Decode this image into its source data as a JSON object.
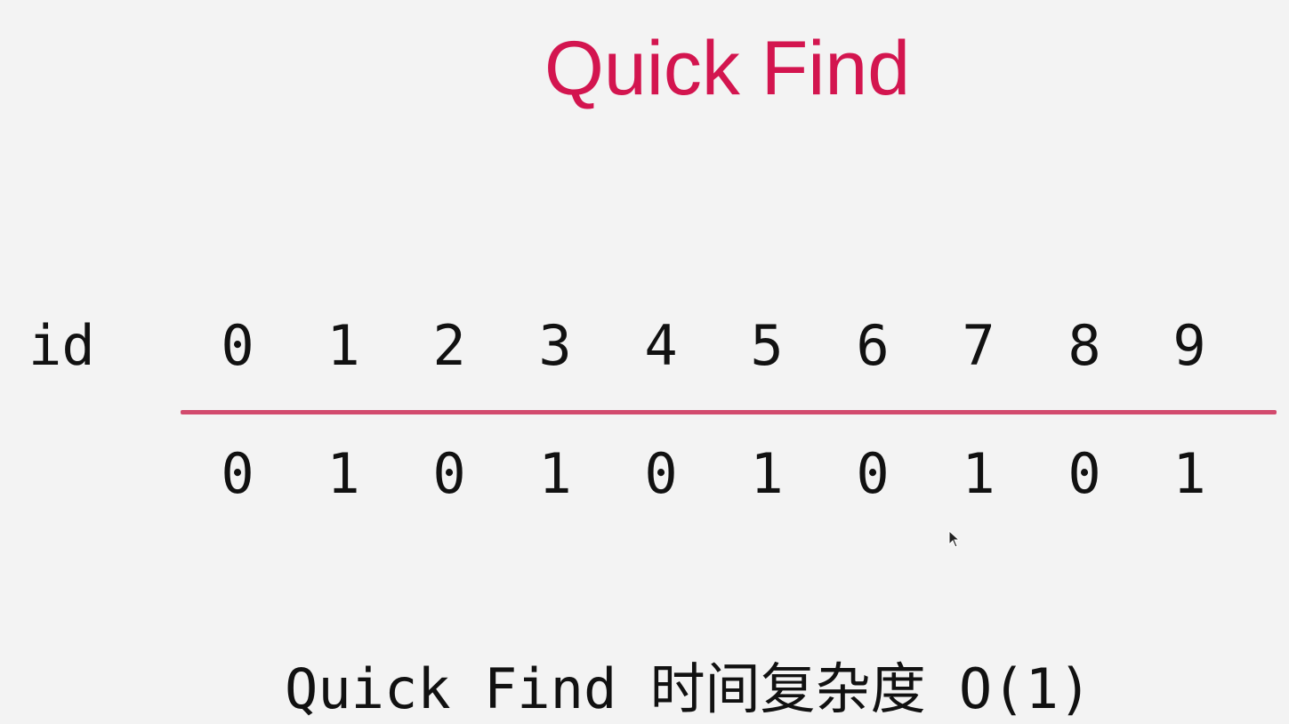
{
  "slide": {
    "title": "Quick Find",
    "row_label": "id",
    "indices": [
      "0",
      "1",
      "2",
      "3",
      "4",
      "5",
      "6",
      "7",
      "8",
      "9"
    ],
    "ids": [
      "0",
      "1",
      "0",
      "1",
      "0",
      "1",
      "0",
      "1",
      "0",
      "1"
    ],
    "caption": "Quick Find 时间复杂度 O(1)"
  },
  "colors": {
    "background": "#f3f3f3",
    "title": "#d3154f",
    "divider": "#d24a6d",
    "text": "#111111"
  },
  "icons": {
    "cursor": "mouse-pointer-icon"
  }
}
